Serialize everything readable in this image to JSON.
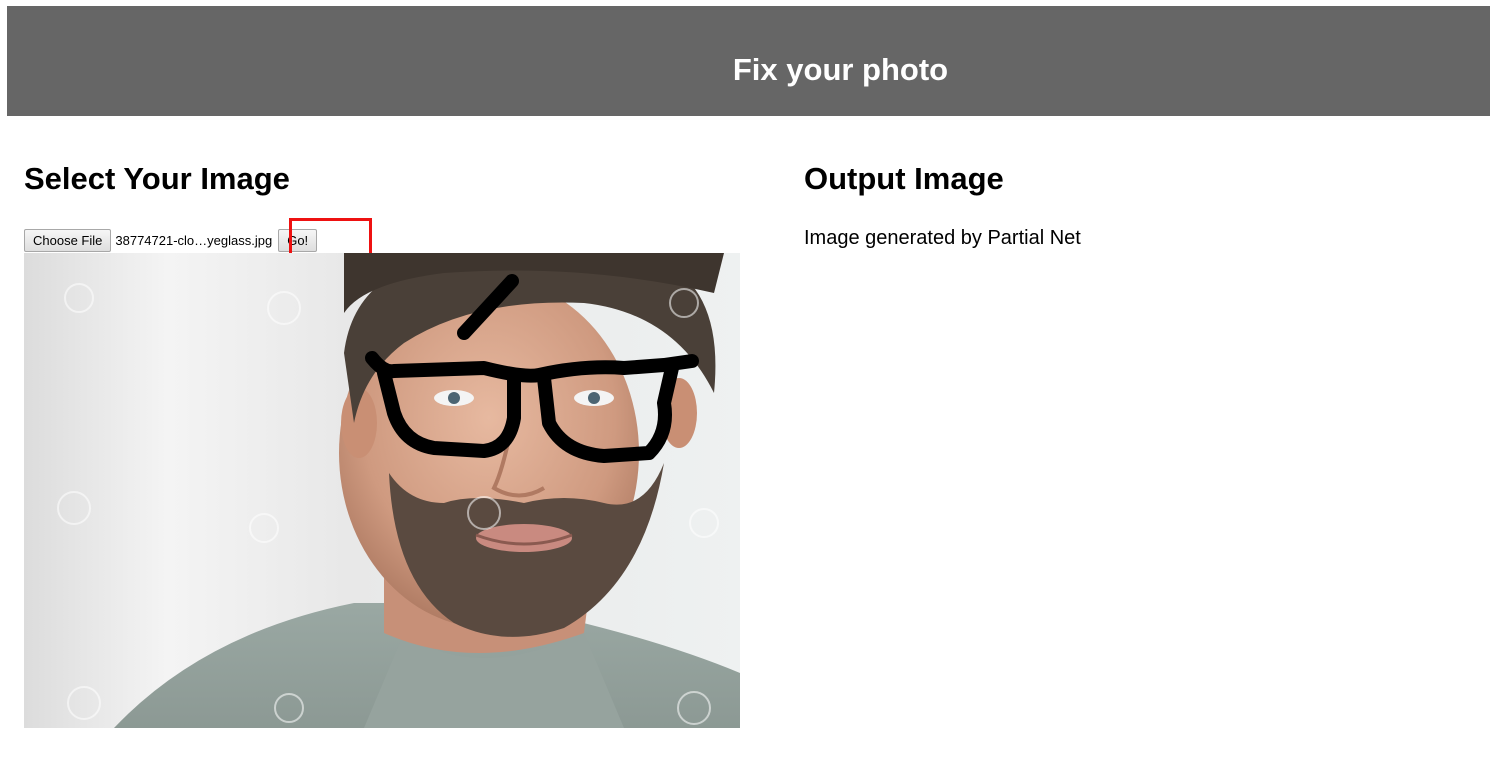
{
  "header": {
    "title": "Fix your photo"
  },
  "input_panel": {
    "title": "Select Your Image",
    "choose_file_label": "Choose File",
    "file_name": "38774721-clo…yeglass.jpg",
    "go_label": "Go!",
    "image_alt": "Photo of smiling bearded man with hand-drawn black eyeglasses and stroke"
  },
  "output_panel": {
    "title": "Output Image",
    "caption": "Image generated by Partial Net"
  },
  "colors": {
    "header_bg": "#666666",
    "highlight": "#ee1111"
  }
}
